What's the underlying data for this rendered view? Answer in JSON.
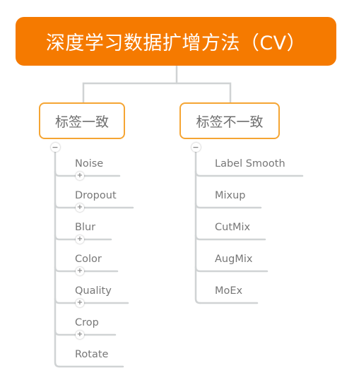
{
  "root": {
    "label": "深度学习数据扩增方法（CV）",
    "color": "#f57a00"
  },
  "branches": [
    {
      "label": "标签一致",
      "border_color": "#f5a533",
      "collapse_icon": "minus",
      "leaves": [
        {
          "label": "Noise",
          "expand_icon": "plus"
        },
        {
          "label": "Dropout",
          "expand_icon": "plus"
        },
        {
          "label": "Blur",
          "expand_icon": "plus"
        },
        {
          "label": "Color",
          "expand_icon": "plus"
        },
        {
          "label": "Quality",
          "expand_icon": "plus"
        },
        {
          "label": "Crop",
          "expand_icon": "plus"
        },
        {
          "label": "Rotate"
        }
      ]
    },
    {
      "label": "标签不一致",
      "border_color": "#f5a533",
      "collapse_icon": "minus",
      "leaves": [
        {
          "label": "Label Smooth"
        },
        {
          "label": "Mixup"
        },
        {
          "label": "CutMix"
        },
        {
          "label": "AugMix"
        },
        {
          "label": "MoEx"
        }
      ]
    }
  ],
  "icons": {
    "minus": "−",
    "plus": "+"
  },
  "line_color": "#d0d3d4"
}
